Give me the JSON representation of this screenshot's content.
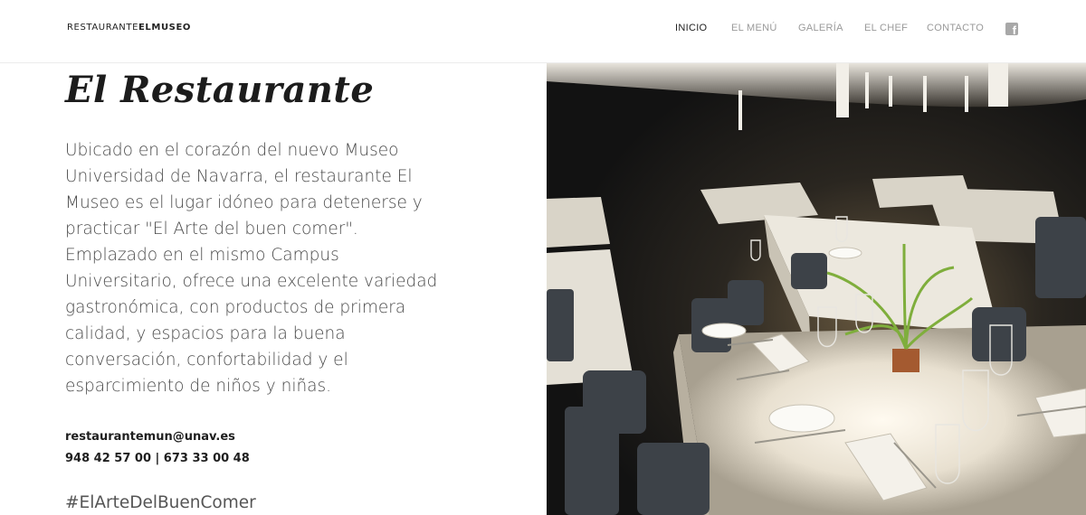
{
  "header": {
    "logo_light": "RESTAURANTE",
    "logo_bold": "ELMUSEO",
    "nav": [
      {
        "label": "INICIO",
        "active": true
      },
      {
        "label": "EL MENÚ",
        "active": false
      },
      {
        "label": "GALERÍA",
        "active": false
      },
      {
        "label": "EL CHEF",
        "active": false
      },
      {
        "label": "CONTACTO",
        "active": false
      }
    ],
    "social_icon": "facebook-icon",
    "social_glyph": "f"
  },
  "main": {
    "title": "El Restaurante",
    "description": "Ubicado en el corazón del nuevo Museo Universidad de Navarra, el restaurante El Museo es el lugar idóneo para detenerse y practicar \"El Arte del buen comer\". Emplazado en el mismo Campus Universitario, ofrece una excelente variedad gastronómica, con productos de primera calidad, y espacios para la buena conversación, confortabilidad y el esparcimiento de niños y niñas.",
    "email": "restaurantemun@unav.es",
    "phones": "948 42 57 00 | 673 33 00 48",
    "hashtag": "#ElArteDelBuenComer"
  },
  "photo": {
    "subject": "restaurant-dining-room-photo"
  }
}
